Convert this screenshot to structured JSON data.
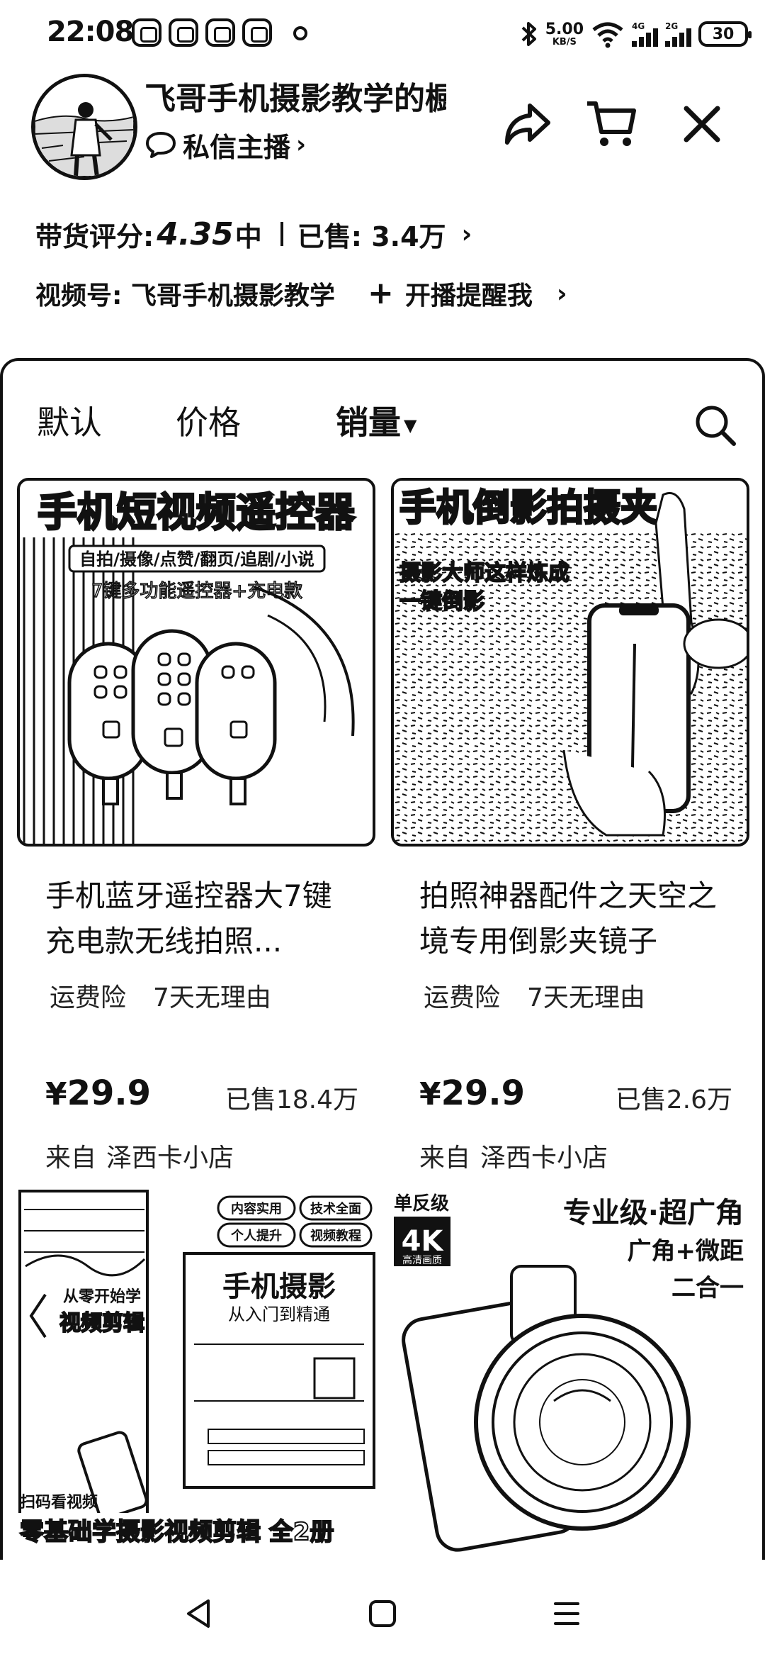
{
  "status_bar": {
    "time": "22:08",
    "net_speed_value": "5.00",
    "net_speed_unit": "KB/S",
    "signal_1_label": "4G",
    "signal_2_label": "2G",
    "battery": "30",
    "icons": [
      "bluetooth-icon",
      "wifi-icon",
      "signal-icon",
      "battery-icon"
    ]
  },
  "shop": {
    "name": "飞哥手机摄影教学的橱窗",
    "message_label": "私信主播",
    "rating_label": "带货评分:",
    "rating_score": "4.35",
    "rating_level": "中",
    "sold_label": "已售: 3.4万",
    "video_label": "视频号: 飞哥手机摄影教学",
    "remind_label": "开播提醒我"
  },
  "sort": {
    "default": "默认",
    "price": "价格",
    "sales": "销量"
  },
  "products": [
    {
      "title": "手机蓝牙遥控器大7键充电款无线拍照...",
      "tags": [
        "运费险",
        "7天无理由"
      ],
      "currency": "¥",
      "price": "29.9",
      "sold": "已售18.4万",
      "from_label": "来自",
      "store": "泽西卡小店",
      "image_text": {
        "headline": "手机短视频遥控器",
        "sub": "自拍/摄像/点赞/翻页/追剧/小说",
        "desc": "7键多功能遥控器+充电款"
      }
    },
    {
      "title": "拍照神器配件之天空之境专用倒影夹镜子",
      "tags": [
        "运费险",
        "7天无理由"
      ],
      "currency": "¥",
      "price": "29.9",
      "sold": "已售2.6万",
      "from_label": "来自",
      "store": "泽西卡小店",
      "image_text": {
        "headline": "手机倒影拍摄夹",
        "line1": "摄影大师这样炼成",
        "line2": "一键倒影"
      }
    },
    {
      "image_text": {
        "tag1": "内容实用",
        "tag2": "技术全面",
        "tag3": "个人提升",
        "tag4": "视频教程",
        "book_title": "手机摄影",
        "book_sub": "从入门到精通",
        "side": "从零开始学",
        "side2": "视频剪辑",
        "scan": "扫码看视频",
        "bottom": "零基础学摄影视频剪辑 全2册"
      }
    },
    {
      "image_text": {
        "badge_top": "单反级",
        "badge_4k": "4K",
        "badge_sub": "高清画质",
        "headline": "专业级·超广角",
        "line1": "广角+微距",
        "line2": "二合一"
      }
    }
  ]
}
